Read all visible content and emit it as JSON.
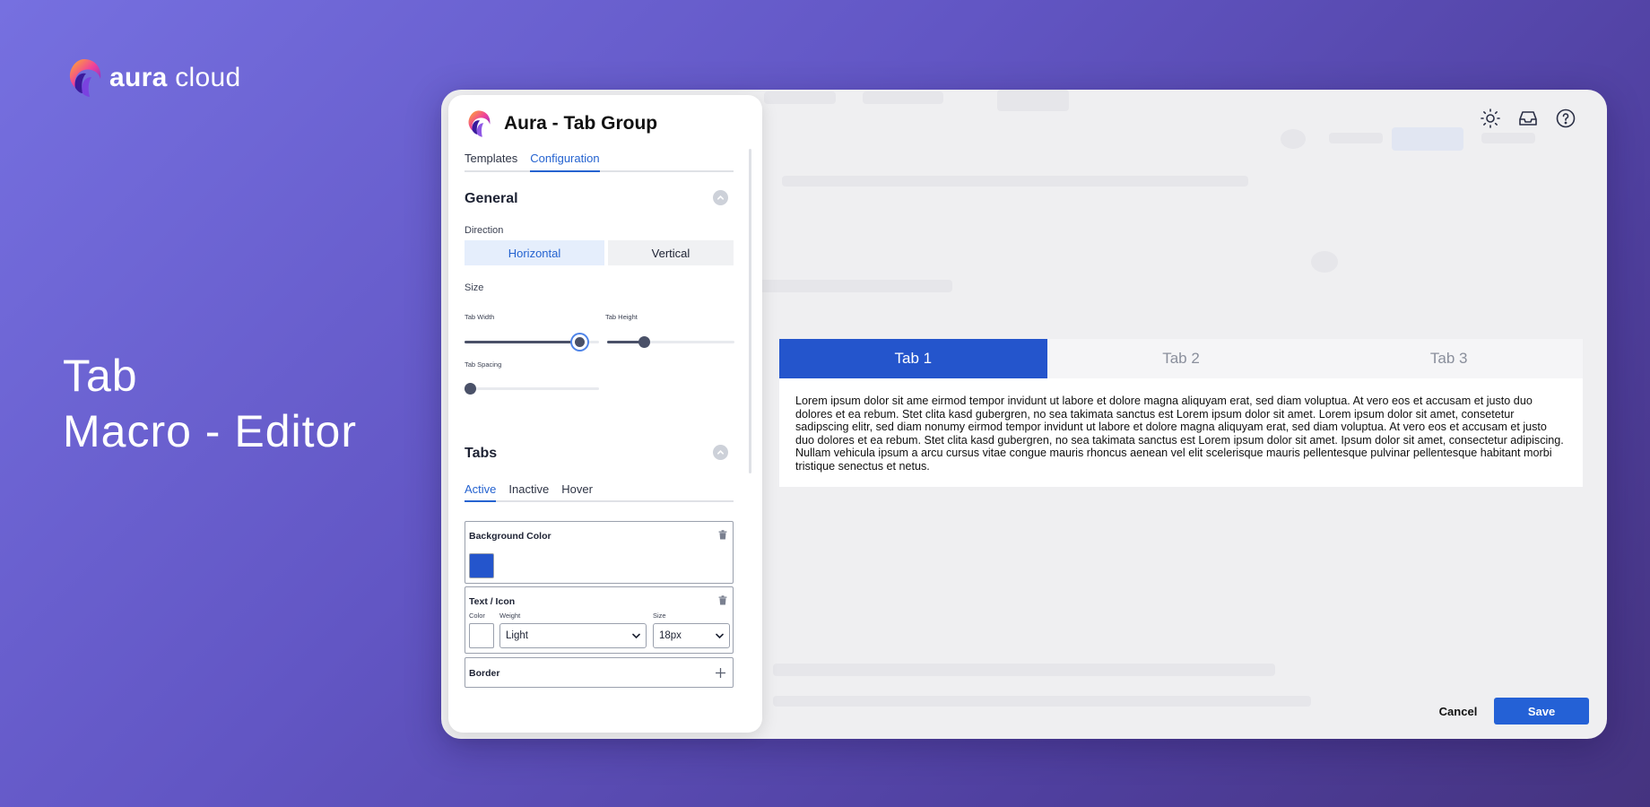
{
  "brand": {
    "name_bold": "aura",
    "name_light": "cloud"
  },
  "hero": {
    "line1": "Tab",
    "line2": "Macro - Editor"
  },
  "top_icons": [
    "sun-icon",
    "inbox-icon",
    "help-icon"
  ],
  "preview": {
    "tabs": [
      {
        "label": "Tab 1",
        "active": true
      },
      {
        "label": "Tab 2",
        "active": false
      },
      {
        "label": "Tab 3",
        "active": false
      }
    ],
    "content": "Lorem ipsum dolor sit ame eirmod tempor invidunt ut labore et dolore magna aliquyam erat, sed diam voluptua. At vero eos et accusam et justo duo dolores et ea rebum. Stet clita kasd gubergren, no sea takimata sanctus est Lorem ipsum dolor sit amet. Lorem ipsum dolor sit amet, consetetur sadipscing elitr, sed diam nonumy eirmod tempor invidunt ut labore et dolore magna aliquyam erat, sed diam voluptua. At vero eos et accusam et justo duo dolores et ea rebum. Stet clita kasd gubergren, no sea takimata sanctus est Lorem ipsum dolor sit amet. Ipsum dolor sit amet, consectetur adipiscing. Nullam vehicula ipsum a arcu cursus vitae congue mauris rhoncus aenean vel elit scelerisque mauris pellentesque pulvinar pellentesque habitant morbi tristique senectus et netus."
  },
  "actions": {
    "cancel": "Cancel",
    "save": "Save"
  },
  "panel": {
    "title": "Aura - Tab Group",
    "tabs": {
      "templates": "Templates",
      "configuration": "Configuration"
    },
    "general": {
      "title": "General",
      "direction_label": "Direction",
      "direction_options": {
        "horizontal": "Horizontal",
        "vertical": "Vertical"
      },
      "direction_selected": "Horizontal",
      "size_label": "Size",
      "tab_width_label": "Tab Width",
      "tab_height_label": "Tab Height",
      "tab_spacing_label": "Tab Spacing",
      "tab_width_level": 0.9,
      "tab_height_level": 0.27,
      "tab_spacing_level": 0.0
    },
    "tabs_section": {
      "title": "Tabs",
      "state_tabs": {
        "active": "Active",
        "inactive": "Inactive",
        "hover": "Hover"
      },
      "background_color": {
        "title": "Background Color",
        "value": "#2455cc"
      },
      "text_icon": {
        "title": "Text / Icon",
        "color_label": "Color",
        "weight_label": "Weight",
        "size_label": "Size",
        "color_value": "#ffffff",
        "weight_value": "Light",
        "size_value": "18px"
      },
      "border": {
        "title": "Border"
      }
    }
  },
  "colors": {
    "accent": "#2563d0",
    "tab_active": "#2455cc",
    "save": "#2461d6"
  }
}
